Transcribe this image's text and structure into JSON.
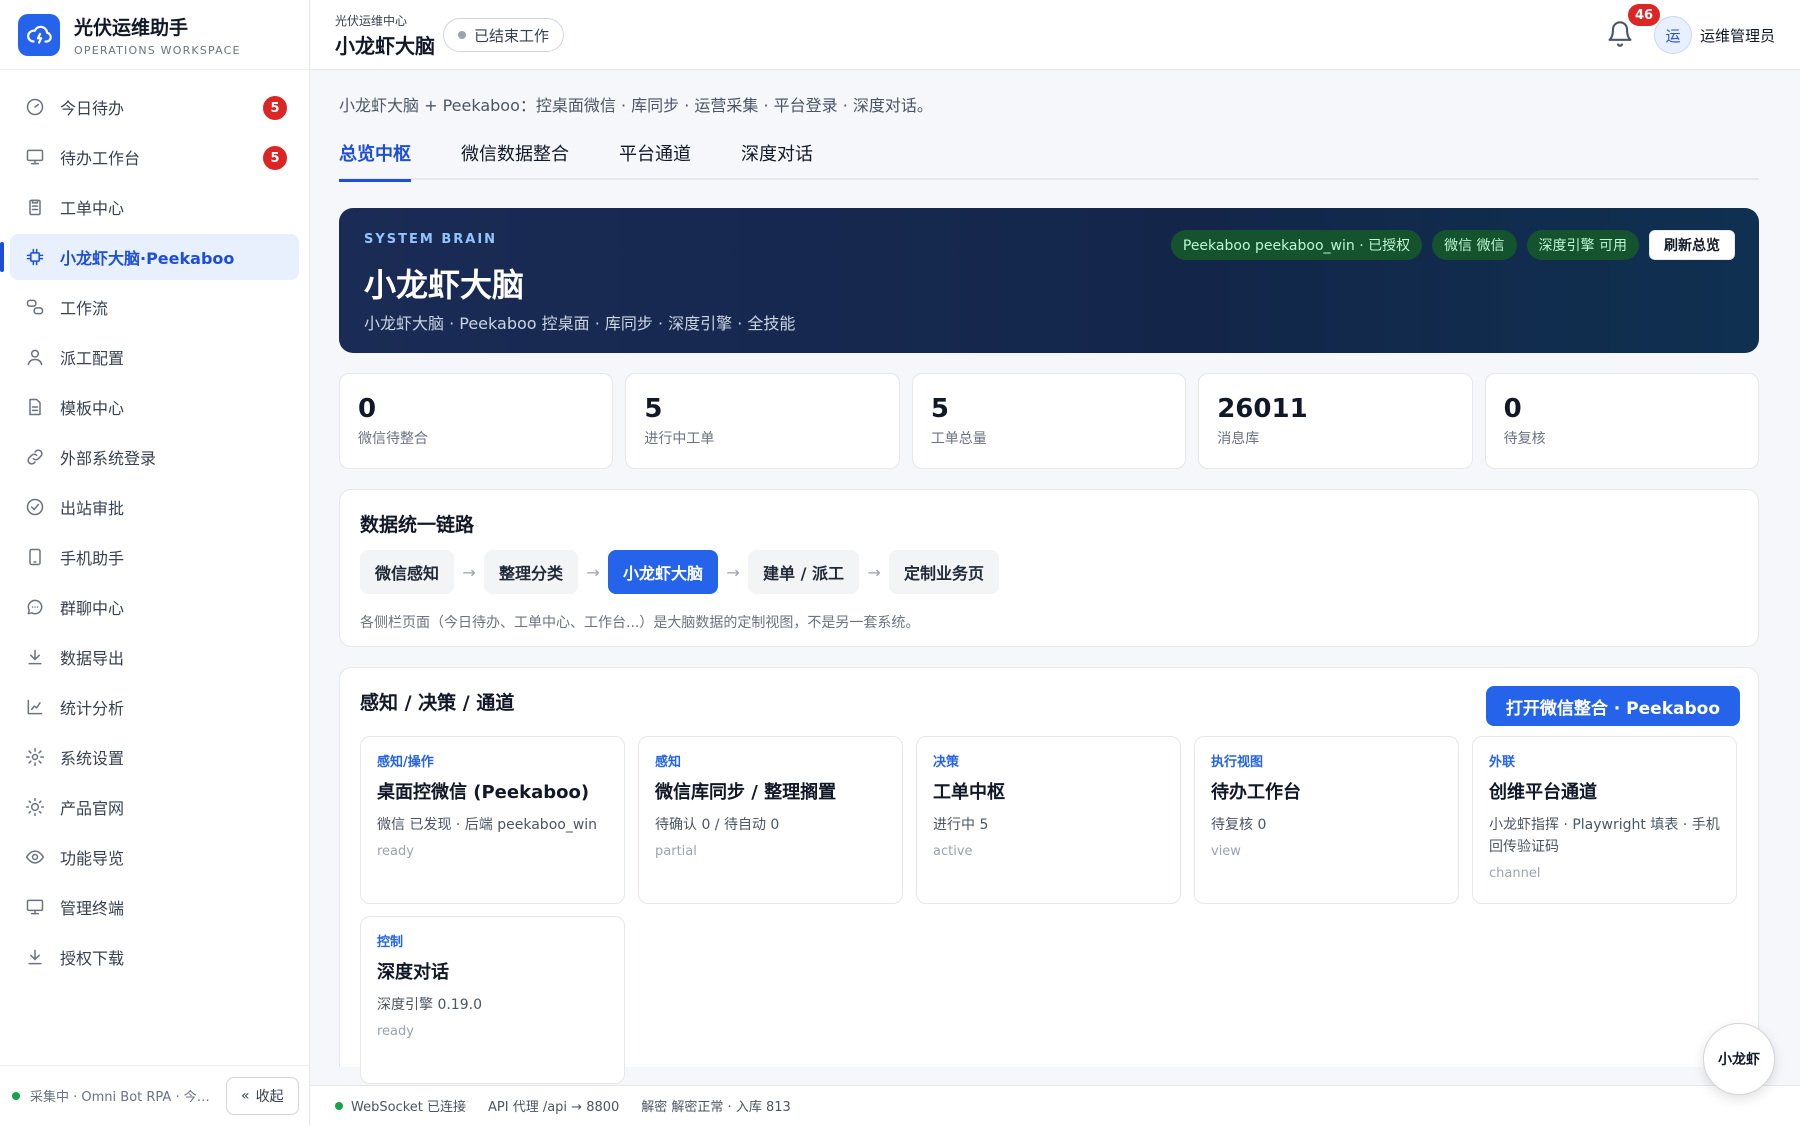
{
  "brand": {
    "title": "光伏运维助手",
    "subtitle": "OPERATIONS WORKSPACE"
  },
  "sidebar": {
    "items": [
      {
        "label": "今日待办",
        "icon": "gauge-icon",
        "badge": "5"
      },
      {
        "label": "待办工作台",
        "icon": "monitor-icon",
        "badge": "5"
      },
      {
        "label": "工单中心",
        "icon": "clipboard-icon"
      },
      {
        "label": "小龙虾大脑·Peekaboo",
        "icon": "chip-icon",
        "active": true
      },
      {
        "label": "工作流",
        "icon": "workflow-icon"
      },
      {
        "label": "派工配置",
        "icon": "user-icon"
      },
      {
        "label": "模板中心",
        "icon": "document-icon"
      },
      {
        "label": "外部系统登录",
        "icon": "link-icon"
      },
      {
        "label": "出站审批",
        "icon": "check-circle-icon"
      },
      {
        "label": "手机助手",
        "icon": "phone-icon"
      },
      {
        "label": "群聊中心",
        "icon": "chat-icon"
      },
      {
        "label": "数据导出",
        "icon": "download-icon"
      },
      {
        "label": "统计分析",
        "icon": "chart-icon"
      },
      {
        "label": "系统设置",
        "icon": "gear-icon"
      },
      {
        "label": "产品官网",
        "icon": "sun-icon"
      },
      {
        "label": "功能导览",
        "icon": "eye-icon"
      },
      {
        "label": "管理终端",
        "icon": "monitor-icon"
      },
      {
        "label": "授权下载",
        "icon": "download-icon"
      }
    ],
    "footer_status": "采集中 · Omni Bot RPA · 今日...",
    "collapse_label": "收起"
  },
  "header": {
    "crumb": "光伏运维中心",
    "title": "小龙虾大脑",
    "state": "已结束工作",
    "notification_count": "46",
    "avatar_text": "运",
    "user_name": "运维管理员"
  },
  "main": {
    "intro": "小龙虾大脑 + Peekaboo：控桌面微信 · 库同步 · 运营采集 · 平台登录 · 深度对话。",
    "tabs": [
      {
        "label": "总览中枢",
        "active": true
      },
      {
        "label": "微信数据整合"
      },
      {
        "label": "平台通道"
      },
      {
        "label": "深度对话"
      }
    ],
    "hero": {
      "eyebrow": "SYSTEM BRAIN",
      "title": "小龙虾大脑",
      "subtitle": "小龙虾大脑 · Peekaboo 控桌面 · 库同步 · 深度引擎 · 全技能",
      "pills": [
        "Peekaboo peekaboo_win · 已授权",
        "微信 微信",
        "深度引擎 可用"
      ],
      "refresh_label": "刷新总览"
    },
    "stats": [
      {
        "value": "0",
        "label": "微信待整合"
      },
      {
        "value": "5",
        "label": "进行中工单"
      },
      {
        "value": "5",
        "label": "工单总量"
      },
      {
        "value": "26011",
        "label": "消息库"
      },
      {
        "value": "0",
        "label": "待复核"
      }
    ],
    "pipeline": {
      "title": "数据统一链路",
      "steps": [
        "微信感知",
        "整理分类",
        "小龙虾大脑",
        "建单 / 派工",
        "定制业务页"
      ],
      "arrow": "→",
      "note": "各侧栏页面（今日待办、工单中心、工作台...）是大脑数据的定制视图，不是另一套系统。"
    },
    "modules": {
      "title": "感知 / 决策 / 通道",
      "open_label": "打开微信整合 · Peekaboo",
      "items": [
        {
          "tag": "感知/操作",
          "title": "桌面控微信 (Peekaboo)",
          "desc": "微信 已发现 · 后端 peekaboo_win",
          "state": "ready"
        },
        {
          "tag": "感知",
          "title": "微信库同步 / 整理搁置",
          "desc": "待确认 0 / 待自动 0",
          "state": "partial"
        },
        {
          "tag": "决策",
          "title": "工单中枢",
          "desc": "进行中 5",
          "state": "active"
        },
        {
          "tag": "执行视图",
          "title": "待办工作台",
          "desc": "待复核 0",
          "state": "view"
        },
        {
          "tag": "外联",
          "title": "创维平台通道",
          "desc": "小龙虾指挥 · Playwright 填表 · 手机回传验证码",
          "state": "channel"
        },
        {
          "tag": "控制",
          "title": "深度对话",
          "desc": "深度引擎 0.19.0",
          "state": "ready"
        }
      ]
    }
  },
  "statusbar": {
    "websocket": "WebSocket 已连接",
    "api": "API 代理 /api → 8800",
    "decrypt": "解密 解密正常 · 入库 813"
  },
  "fab_label": "小龙虾"
}
